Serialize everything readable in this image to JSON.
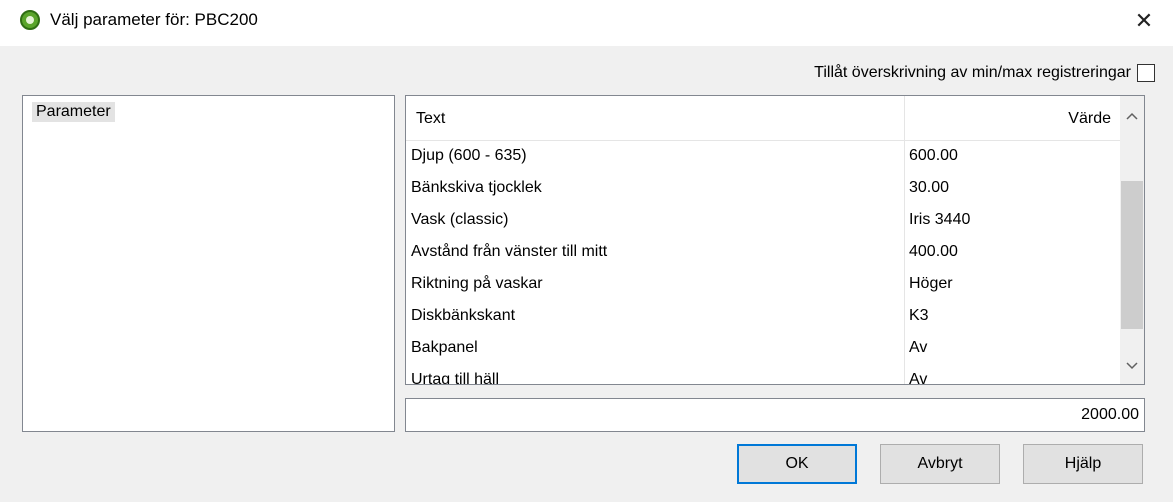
{
  "window": {
    "title": "Välj parameter för: PBC200"
  },
  "overwrite": {
    "label": "Tillåt överskrivning av min/max registreringar",
    "checked": false
  },
  "param_list": {
    "items": [
      "Parameter"
    ]
  },
  "table": {
    "headers": {
      "text": "Text",
      "value": "Värde"
    },
    "rows": [
      {
        "text": "Djup (600 - 635)",
        "value": "600.00"
      },
      {
        "text": "Bänkskiva tjocklek",
        "value": "30.00"
      },
      {
        "text": "Vask (classic)",
        "value": "Iris 3440"
      },
      {
        "text": "Avstånd från vänster till mitt",
        "value": "400.00"
      },
      {
        "text": "Riktning på vaskar",
        "value": "Höger"
      },
      {
        "text": "Diskbänkskant",
        "value": "K3"
      },
      {
        "text": "Bakpanel",
        "value": "Av"
      },
      {
        "text": "Urtag till häll",
        "value": "Av"
      }
    ]
  },
  "value_field": {
    "value": "2000.00"
  },
  "buttons": {
    "ok": "OK",
    "cancel": "Avbryt",
    "help": "Hjälp"
  },
  "icons": {
    "app": "app-logo-icon",
    "close": "close-icon",
    "scroll_up": "chevron-up-icon",
    "scroll_down": "chevron-down-icon"
  },
  "colors": {
    "accent": "#0078d7",
    "selection": "#e3e3e3"
  }
}
